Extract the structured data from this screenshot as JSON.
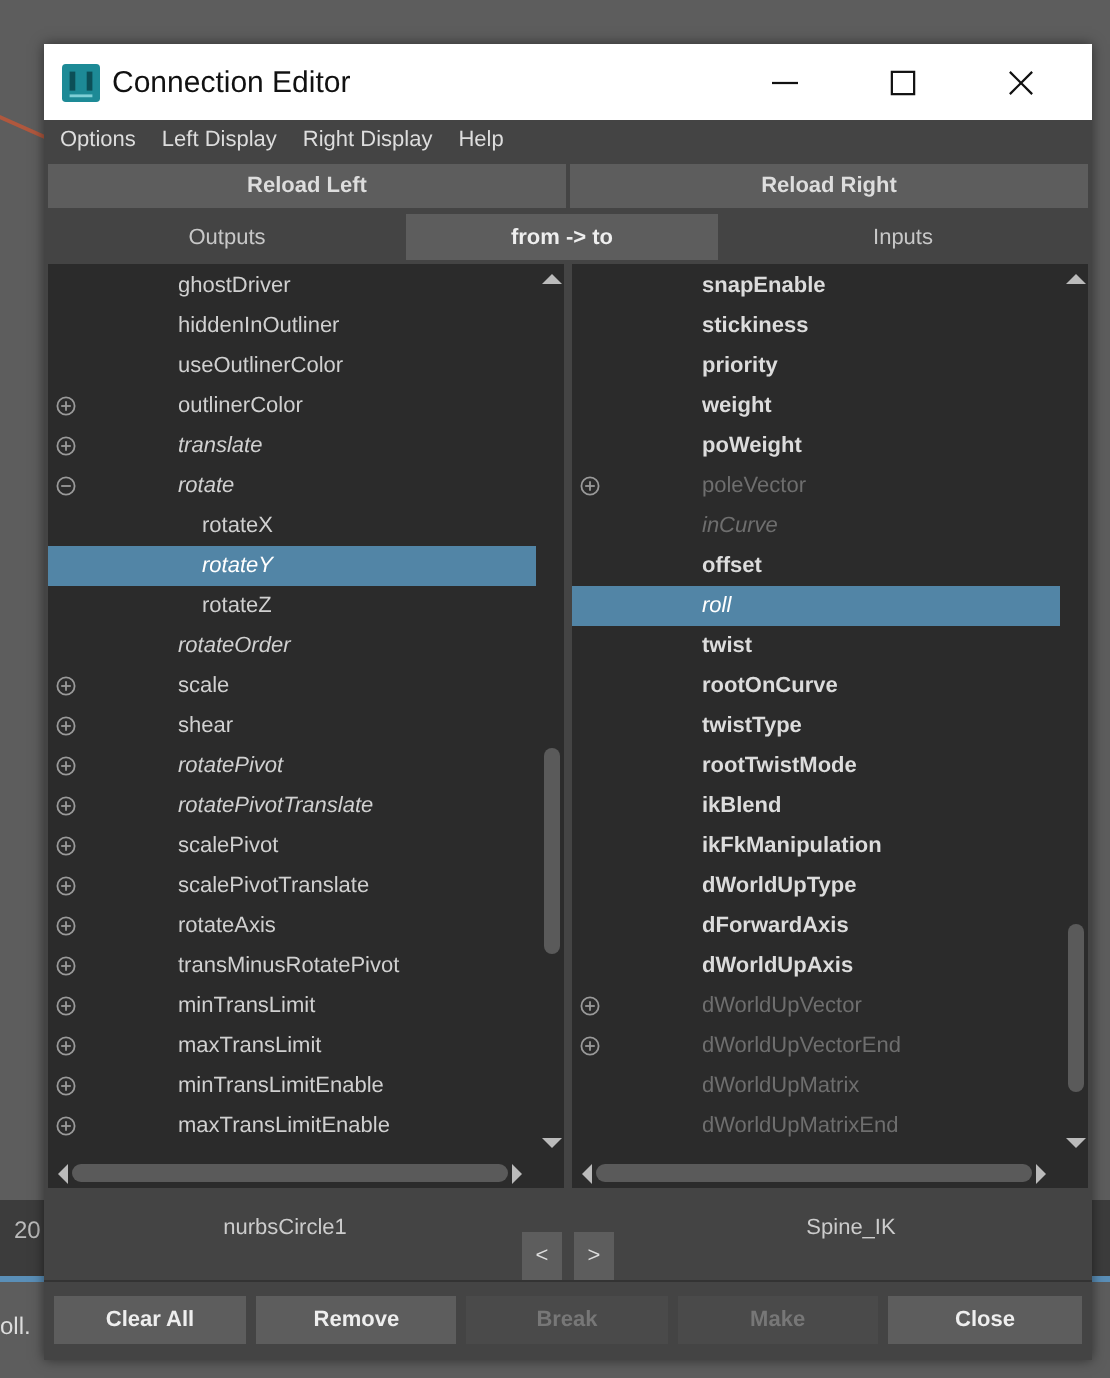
{
  "background_texts": [
    "20",
    "oll."
  ],
  "window": {
    "title": "Connection Editor"
  },
  "menu": [
    "Options",
    "Left Display",
    "Right Display",
    "Help"
  ],
  "reload_buttons": [
    "Reload Left",
    "Reload Right"
  ],
  "tabs": [
    {
      "label": "Outputs",
      "selected": false
    },
    {
      "label": "from -> to",
      "selected": true
    },
    {
      "label": "Inputs",
      "selected": false
    }
  ],
  "left_list": [
    {
      "label": "ghostDriver",
      "expandable": false,
      "italic": false,
      "bold": false,
      "dim": false,
      "selected": false
    },
    {
      "label": "hiddenInOutliner",
      "expandable": false,
      "italic": false,
      "bold": false,
      "dim": false,
      "selected": false
    },
    {
      "label": "useOutlinerColor",
      "expandable": false,
      "italic": false,
      "bold": false,
      "dim": false,
      "selected": false
    },
    {
      "label": "outlinerColor",
      "expandable": true,
      "expanded": false,
      "italic": false,
      "bold": false,
      "dim": false,
      "selected": false
    },
    {
      "label": "translate",
      "expandable": true,
      "expanded": false,
      "italic": true,
      "bold": false,
      "dim": false,
      "selected": false
    },
    {
      "label": "rotate",
      "expandable": true,
      "expanded": true,
      "italic": true,
      "bold": false,
      "dim": false,
      "selected": false,
      "children": [
        {
          "label": "rotateX",
          "expandable": false,
          "italic": false,
          "bold": false,
          "dim": false,
          "selected": false
        },
        {
          "label": "rotateY",
          "expandable": false,
          "italic": true,
          "bold": false,
          "dim": false,
          "selected": true
        },
        {
          "label": "rotateZ",
          "expandable": false,
          "italic": false,
          "bold": false,
          "dim": false,
          "selected": false
        }
      ]
    },
    {
      "label": "rotateOrder",
      "expandable": false,
      "italic": true,
      "bold": false,
      "dim": false,
      "selected": false
    },
    {
      "label": "scale",
      "expandable": true,
      "expanded": false,
      "italic": false,
      "bold": false,
      "dim": false,
      "selected": false
    },
    {
      "label": "shear",
      "expandable": true,
      "expanded": false,
      "italic": false,
      "bold": false,
      "dim": false,
      "selected": false
    },
    {
      "label": "rotatePivot",
      "expandable": true,
      "expanded": false,
      "italic": true,
      "bold": false,
      "dim": false,
      "selected": false
    },
    {
      "label": "rotatePivotTranslate",
      "expandable": true,
      "expanded": false,
      "italic": true,
      "bold": false,
      "dim": false,
      "selected": false
    },
    {
      "label": "scalePivot",
      "expandable": true,
      "expanded": false,
      "italic": false,
      "bold": false,
      "dim": false,
      "selected": false
    },
    {
      "label": "scalePivotTranslate",
      "expandable": true,
      "expanded": false,
      "italic": false,
      "bold": false,
      "dim": false,
      "selected": false
    },
    {
      "label": "rotateAxis",
      "expandable": true,
      "expanded": false,
      "italic": false,
      "bold": false,
      "dim": false,
      "selected": false
    },
    {
      "label": "transMinusRotatePivot",
      "expandable": true,
      "expanded": false,
      "italic": false,
      "bold": false,
      "dim": false,
      "selected": false
    },
    {
      "label": "minTransLimit",
      "expandable": true,
      "expanded": false,
      "italic": false,
      "bold": false,
      "dim": false,
      "selected": false
    },
    {
      "label": "maxTransLimit",
      "expandable": true,
      "expanded": false,
      "italic": false,
      "bold": false,
      "dim": false,
      "selected": false
    },
    {
      "label": "minTransLimitEnable",
      "expandable": true,
      "expanded": false,
      "italic": false,
      "bold": false,
      "dim": false,
      "selected": false
    },
    {
      "label": "maxTransLimitEnable",
      "expandable": true,
      "expanded": false,
      "italic": false,
      "bold": false,
      "dim": false,
      "selected": false
    }
  ],
  "right_list": [
    {
      "label": "snapEnable",
      "expandable": false,
      "italic": false,
      "bold": true,
      "dim": false,
      "selected": false
    },
    {
      "label": "stickiness",
      "expandable": false,
      "italic": false,
      "bold": true,
      "dim": false,
      "selected": false
    },
    {
      "label": "priority",
      "expandable": false,
      "italic": false,
      "bold": true,
      "dim": false,
      "selected": false
    },
    {
      "label": "weight",
      "expandable": false,
      "italic": false,
      "bold": true,
      "dim": false,
      "selected": false
    },
    {
      "label": "poWeight",
      "expandable": false,
      "italic": false,
      "bold": true,
      "dim": false,
      "selected": false
    },
    {
      "label": "poleVector",
      "expandable": true,
      "expanded": false,
      "italic": false,
      "bold": false,
      "dim": true,
      "selected": false
    },
    {
      "label": "inCurve",
      "expandable": false,
      "italic": true,
      "bold": false,
      "dim": true,
      "selected": false
    },
    {
      "label": "offset",
      "expandable": false,
      "italic": false,
      "bold": true,
      "dim": false,
      "selected": false
    },
    {
      "label": "roll",
      "expandable": false,
      "italic": true,
      "bold": false,
      "dim": false,
      "selected": true
    },
    {
      "label": "twist",
      "expandable": false,
      "italic": false,
      "bold": true,
      "dim": false,
      "selected": false
    },
    {
      "label": "rootOnCurve",
      "expandable": false,
      "italic": false,
      "bold": true,
      "dim": false,
      "selected": false
    },
    {
      "label": "twistType",
      "expandable": false,
      "italic": false,
      "bold": true,
      "dim": false,
      "selected": false
    },
    {
      "label": "rootTwistMode",
      "expandable": false,
      "italic": false,
      "bold": true,
      "dim": false,
      "selected": false
    },
    {
      "label": "ikBlend",
      "expandable": false,
      "italic": false,
      "bold": true,
      "dim": false,
      "selected": false
    },
    {
      "label": "ikFkManipulation",
      "expandable": false,
      "italic": false,
      "bold": true,
      "dim": false,
      "selected": false
    },
    {
      "label": "dWorldUpType",
      "expandable": false,
      "italic": false,
      "bold": true,
      "dim": false,
      "selected": false
    },
    {
      "label": "dForwardAxis",
      "expandable": false,
      "italic": false,
      "bold": true,
      "dim": false,
      "selected": false
    },
    {
      "label": "dWorldUpAxis",
      "expandable": false,
      "italic": false,
      "bold": true,
      "dim": false,
      "selected": false
    },
    {
      "label": "dWorldUpVector",
      "expandable": true,
      "expanded": false,
      "italic": false,
      "bold": false,
      "dim": true,
      "selected": false
    },
    {
      "label": "dWorldUpVectorEnd",
      "expandable": true,
      "expanded": false,
      "italic": false,
      "bold": false,
      "dim": true,
      "selected": false
    },
    {
      "label": "dWorldUpMatrix",
      "expandable": false,
      "italic": false,
      "bold": false,
      "dim": true,
      "selected": false
    },
    {
      "label": "dWorldUpMatrixEnd",
      "expandable": false,
      "italic": false,
      "bold": false,
      "dim": true,
      "selected": false
    }
  ],
  "left_node": "nurbsCircle1",
  "right_node": "Spine_IK",
  "swap_buttons": [
    "<",
    ">"
  ],
  "buttons": [
    {
      "label": "Clear All",
      "disabled": false
    },
    {
      "label": "Remove",
      "disabled": false
    },
    {
      "label": "Break",
      "disabled": true
    },
    {
      "label": "Make",
      "disabled": true
    },
    {
      "label": "Close",
      "disabled": false
    }
  ]
}
